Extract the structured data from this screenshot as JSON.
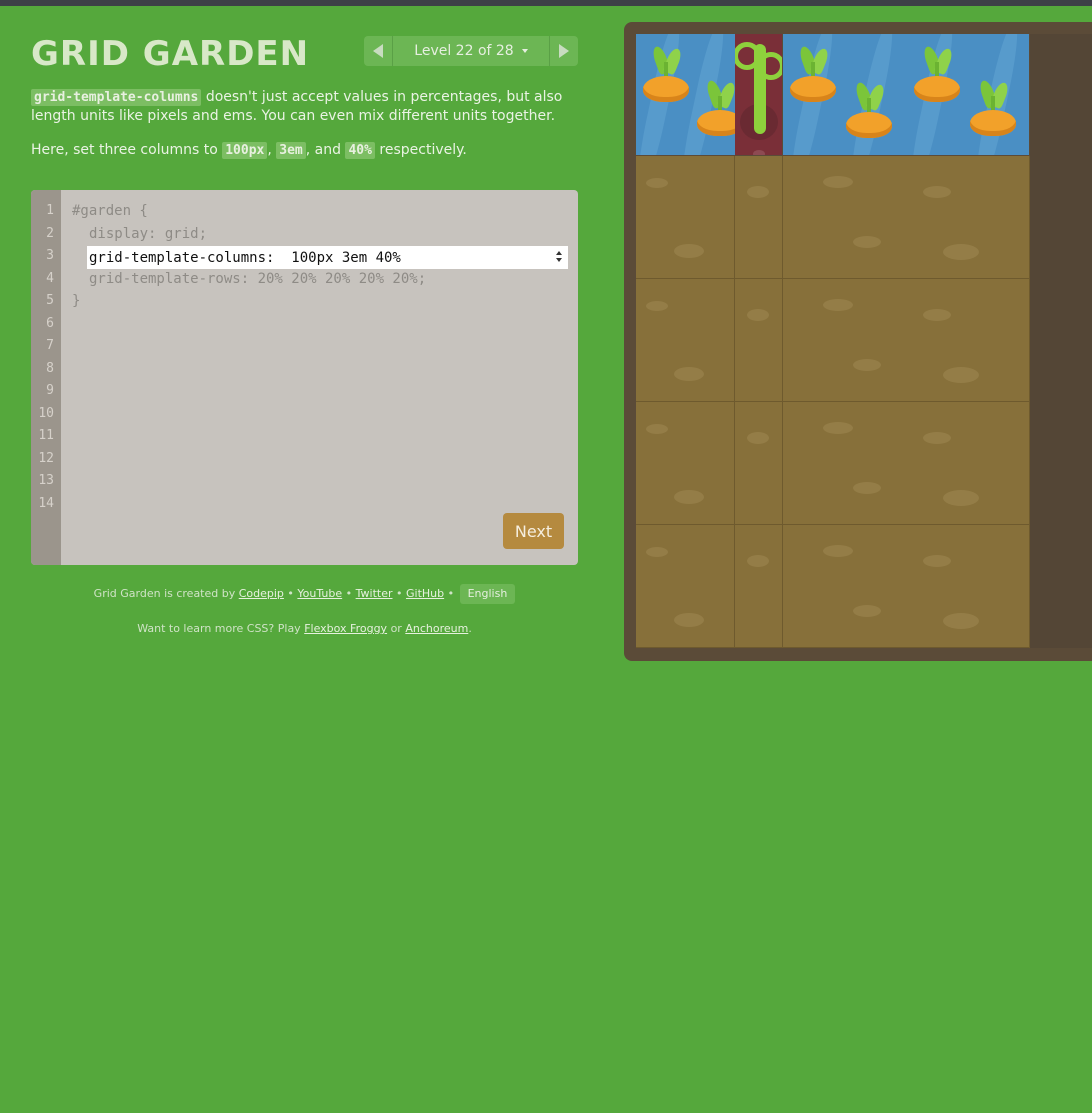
{
  "header": {
    "title": "GRID GARDEN",
    "level_label": "Level 22 of 28"
  },
  "instructions": {
    "p1_code": "grid-template-columns",
    "p1_text": " doesn't just accept values in percentages, but also length units like pixels and ems. You can even mix different units together.",
    "p2_prefix": "Here, set three columns to ",
    "p2_code1": "100px",
    "p2_sep1": ", ",
    "p2_code2": "3em",
    "p2_sep2": ", and ",
    "p2_code3": "40%",
    "p2_suffix": " respectively."
  },
  "editor": {
    "line_numbers": [
      "1",
      "2",
      "3",
      "4",
      "5",
      "6",
      "7",
      "8",
      "9",
      "10",
      "11",
      "12",
      "13",
      "14"
    ],
    "line1": "#garden {",
    "line2": "display: grid;",
    "input_value": "grid-template-columns:  100px 3em 40%",
    "line4": "grid-template-rows: 20% 20% 20% 20% 20%;",
    "line5": "}",
    "next_label": "Next"
  },
  "footer": {
    "credit_prefix": "Grid Garden is created by ",
    "codepip": "Codepip",
    "youtube": "YouTube",
    "twitter": "Twitter",
    "github": "GitHub",
    "dot": " • ",
    "language": "English",
    "more_prefix": "Want to learn more CSS? Play ",
    "flexbox_froggy": "Flexbox Froggy",
    "or": " or ",
    "anchoreum": "Anchoreum",
    "period": "."
  },
  "garden": {
    "rows": 5,
    "water_row": 1,
    "weed_column": 2,
    "carrot_columns": [
      1,
      3
    ]
  },
  "colors": {
    "background": "#55a83c",
    "board": "#5b4b38",
    "dirt": "#87703a",
    "water": "#4a8fc4",
    "weed": "#7a2f38",
    "carrot": "#f2a12a",
    "next_button": "#b58a3f"
  }
}
